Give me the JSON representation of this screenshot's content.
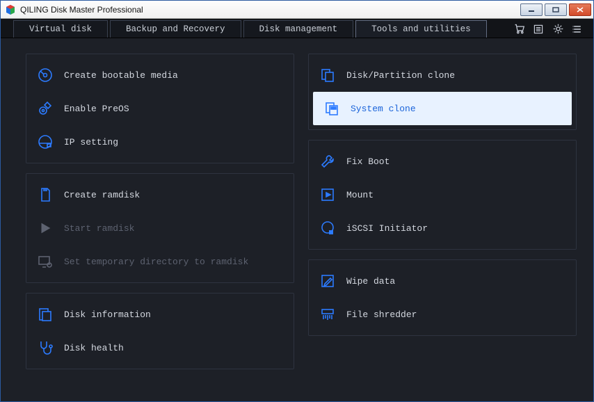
{
  "window": {
    "title": "QILING Disk Master Professional"
  },
  "tabs": {
    "virtual_disk": "Virtual disk",
    "backup_recovery": "Backup and Recovery",
    "disk_management": "Disk management",
    "tools_utilities": "Tools and utilities"
  },
  "left": {
    "group1": {
      "create_bootable": "Create bootable media",
      "enable_preos": "Enable PreOS",
      "ip_setting": "IP setting"
    },
    "group2": {
      "create_ramdisk": "Create ramdisk",
      "start_ramdisk": "Start ramdisk",
      "set_temp_dir": "Set temporary directory to ramdisk"
    },
    "group3": {
      "disk_info": "Disk information",
      "disk_health": "Disk health"
    }
  },
  "right": {
    "group1": {
      "disk_partition_clone": "Disk/Partition clone",
      "system_clone": "System clone"
    },
    "group2": {
      "fix_boot": "Fix Boot",
      "mount": "Mount",
      "iscsi": "iSCSI Initiator"
    },
    "group3": {
      "wipe_data": "Wipe data",
      "file_shredder": "File shredder"
    }
  }
}
